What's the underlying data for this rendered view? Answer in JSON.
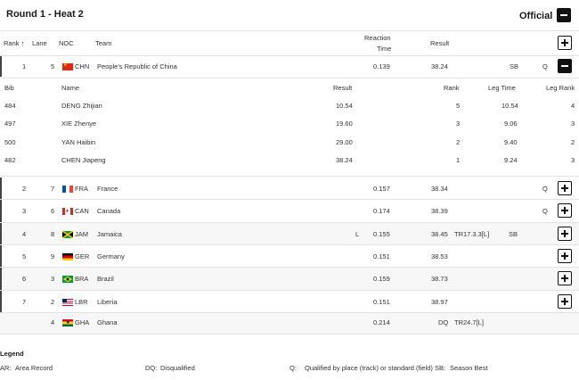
{
  "title": "Round 1 - Heat 2",
  "status": "Official",
  "headers": {
    "rank": "Rank",
    "rank_sort": "↑",
    "lane": "Lane",
    "noc": "NOC",
    "team": "Team",
    "reaction_time": [
      "Reaction",
      "Time"
    ],
    "result": "Result"
  },
  "expanded": {
    "rank": "1",
    "lane": "5",
    "noc": "CHN",
    "team": "People's Republic of China",
    "reaction": "0.139",
    "result": "38.24",
    "record": "SB",
    "qual": "Q",
    "sub_headers": {
      "bib": "Bib",
      "name": "Name",
      "result": "Result",
      "rank": "Rank",
      "leg_time": "Leg Time",
      "leg_rank": "Leg Rank"
    },
    "athletes": [
      {
        "bib": "484",
        "name": "DENG Zhijian",
        "result": "10.54",
        "rank": "5",
        "leg_time": "10.54",
        "leg_rank": "4"
      },
      {
        "bib": "497",
        "name": "XIE Zhenye",
        "result": "19.60",
        "rank": "3",
        "leg_time": "9.06",
        "leg_rank": "3"
      },
      {
        "bib": "500",
        "name": "YAN Haibin",
        "result": "29.00",
        "rank": "2",
        "leg_time": "9.40",
        "leg_rank": "2"
      },
      {
        "bib": "482",
        "name": "CHEN Jiapeng",
        "result": "38.24",
        "rank": "1",
        "leg_time": "9.24",
        "leg_rank": "3"
      }
    ]
  },
  "rows": [
    {
      "rank": "2",
      "lane": "7",
      "noc": "FRA",
      "team": "France",
      "flag": "fra",
      "false_start": "",
      "reaction": "0.157",
      "result": "38.34",
      "note": "",
      "record": "",
      "qual": "Q"
    },
    {
      "rank": "3",
      "lane": "6",
      "noc": "CAN",
      "team": "Canada",
      "flag": "can",
      "false_start": "",
      "reaction": "0.174",
      "result": "38.39",
      "note": "",
      "record": "",
      "qual": "Q"
    },
    {
      "rank": "4",
      "lane": "8",
      "noc": "JAM",
      "team": "Jamaica",
      "flag": "jam",
      "false_start": "L",
      "reaction": "0.155",
      "result": "38.45",
      "note": "TR17.3.3[L]",
      "record": "SB",
      "qual": ""
    },
    {
      "rank": "5",
      "lane": "9",
      "noc": "GER",
      "team": "Germany",
      "flag": "ger",
      "false_start": "",
      "reaction": "0.151",
      "result": "38.53",
      "note": "",
      "record": "",
      "qual": ""
    },
    {
      "rank": "6",
      "lane": "3",
      "noc": "BRA",
      "team": "Brazil",
      "flag": "bra",
      "false_start": "",
      "reaction": "0.159",
      "result": "38.73",
      "note": "",
      "record": "",
      "qual": ""
    },
    {
      "rank": "7",
      "lane": "2",
      "noc": "LBR",
      "team": "Liberia",
      "flag": "lbr",
      "false_start": "",
      "reaction": "0.151",
      "result": "38.97",
      "note": "",
      "record": "",
      "qual": ""
    },
    {
      "rank": "",
      "lane": "4",
      "noc": "GHA",
      "team": "Ghana",
      "flag": "gha",
      "false_start": "",
      "reaction": "0.214",
      "result": "DQ",
      "note": "TR24.7[L]",
      "record": "",
      "qual": ""
    }
  ],
  "legend": {
    "title": "Legend",
    "items": [
      {
        "abbr": "AR:",
        "text": "Area Record"
      },
      {
        "abbr": "DQ:",
        "text": "Disqualified"
      },
      {
        "abbr": "Q:",
        "text": "Qualified by place (track) or standard (field)"
      },
      {
        "abbr": "SB:",
        "text": "Season Best"
      }
    ]
  },
  "colors": {
    "accent": "#111111",
    "divider": "#e2e2e2",
    "text": "#333333"
  }
}
